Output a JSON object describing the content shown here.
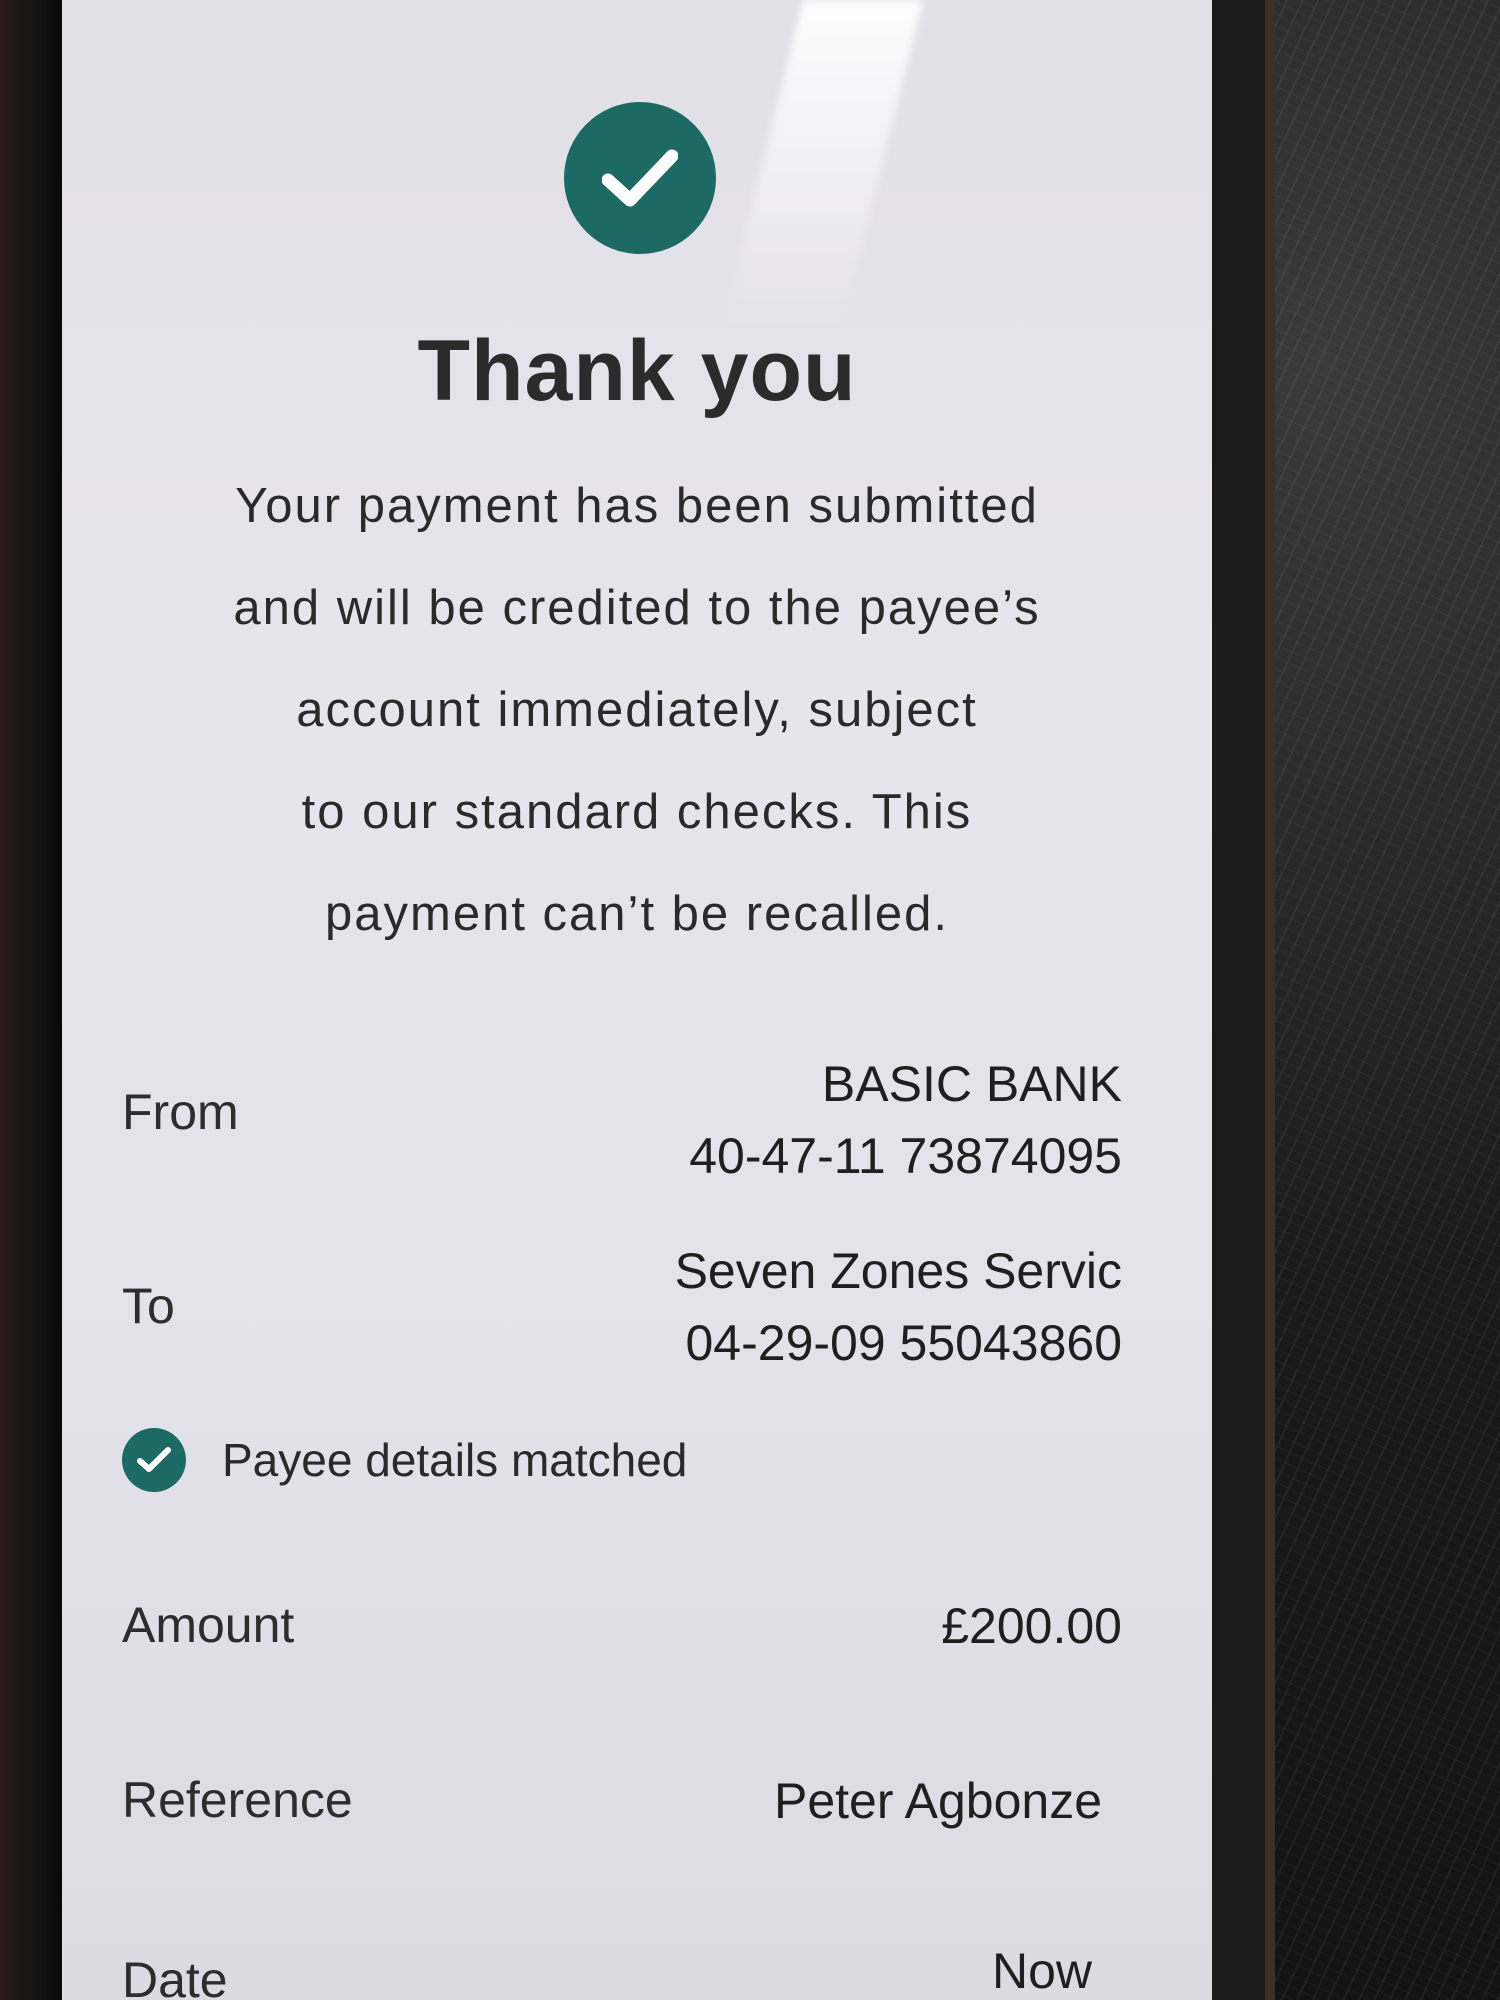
{
  "confirmation": {
    "title": "Thank you",
    "message_lines": [
      "Your payment has been submitted",
      "and will be credited to the payee’s",
      "account immediately, subject",
      "to our standard checks. This",
      "payment can’t be recalled."
    ],
    "icon": "check-circle-icon",
    "accent_color": "#1c6a63"
  },
  "details": {
    "from": {
      "label": "From",
      "name": "BASIC BANK",
      "account": "40-47-11 73874095"
    },
    "to": {
      "label": "To",
      "name": "Seven Zones Servic",
      "account": "04-29-09 55043860"
    },
    "payee_check": {
      "icon": "check-circle-icon",
      "text": "Payee details matched"
    },
    "amount": {
      "label": "Amount",
      "value": "£200.00"
    },
    "reference": {
      "label": "Reference",
      "value": "Peter Agbonze"
    },
    "date": {
      "label": "Date",
      "value": "Now"
    }
  }
}
